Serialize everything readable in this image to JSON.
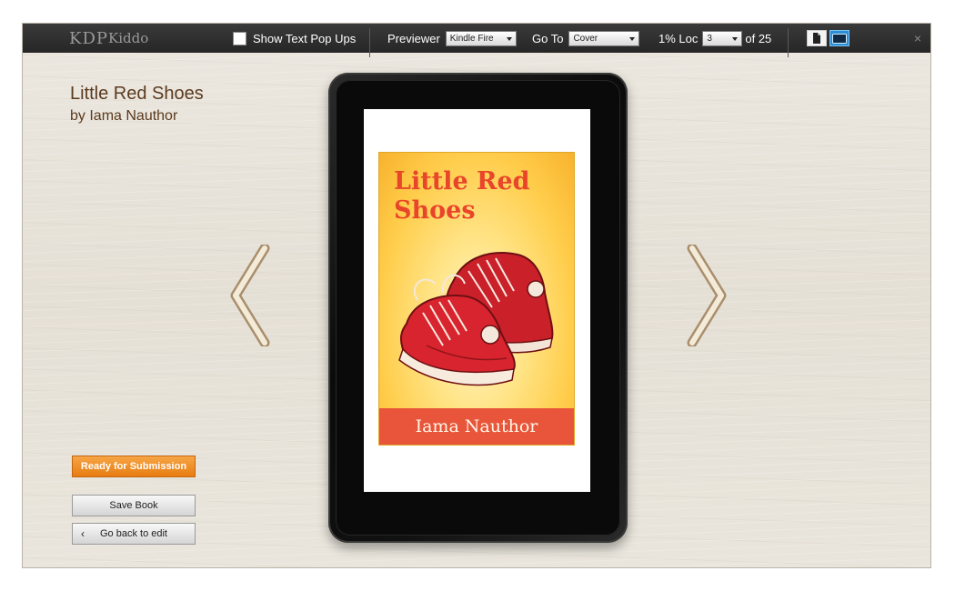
{
  "toolbar": {
    "logo_main": "KDP",
    "logo_sub": "Kiddo",
    "show_popups_label": "Show Text Pop Ups",
    "previewer_label": "Previewer",
    "previewer_value": "Kindle Fire",
    "goto_label": "Go To",
    "goto_value": "Cover",
    "progress_text": "1% Loc",
    "loc_value": "3",
    "loc_total": "of 25",
    "close_label": "×"
  },
  "book": {
    "title": "Little Red Shoes",
    "byline": "by Iama Nauthor"
  },
  "cover": {
    "title": "Little Red Shoes",
    "author": "Iama Nauthor"
  },
  "actions": {
    "submit_label": "Ready for Submission",
    "save_label": "Save Book",
    "back_label": "Go back to edit",
    "back_chevron": "‹"
  },
  "icons": {
    "prev": "chevron-left-icon",
    "next": "chevron-right-icon",
    "page_view": "single-page-icon",
    "tablet_view": "tablet-icon",
    "close": "close-icon"
  },
  "colors": {
    "submit": "#e77d12",
    "cover_title": "#e8452b",
    "cover_band": "#e8553a",
    "view_active": "#2a8ed6"
  }
}
